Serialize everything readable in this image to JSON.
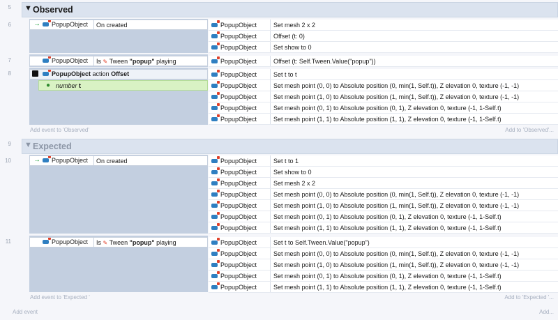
{
  "groups": [
    {
      "line": "5",
      "title": "Observed",
      "add_event": "Add event to 'Observed'",
      "add_to": "Add to 'Observed'..."
    },
    {
      "line": "9",
      "title": "Expected",
      "add_event": "Add event to 'Expected '",
      "add_to": "Add to 'Expected '..."
    }
  ],
  "line_numbers": [
    "6",
    "7",
    "8",
    "10",
    "11"
  ],
  "footer": {
    "add_event": "Add event",
    "add": "Add..."
  },
  "object_name": "PopupObject",
  "conditions": [
    {
      "object": "PopupObject",
      "text": "On created"
    },
    {
      "object": "PopupObject",
      "is": "Is",
      "tween_label": "Tween",
      "tween_name": "\"popup\"",
      "playing": "playing"
    },
    {
      "object": "PopupObject",
      "action_word": "action",
      "action_name": "Offset"
    },
    {
      "object": "PopupObject",
      "text": "On created"
    },
    {
      "object": "PopupObject",
      "is": "Is",
      "tween_label": "Tween",
      "tween_name": "\"popup\"",
      "playing": "playing"
    }
  ],
  "parameter": {
    "type": "number",
    "name": "t"
  },
  "actions": [
    "Set mesh 2 x 2",
    "Offset (t: 0)",
    "Set show to 0",
    "Offset (t: Self.Tween.Value(\"popup\"))",
    "Set t to t",
    "Set mesh point (0, 0) to Absolute position (0, min(1, Self.t)), Z elevation 0, texture (-1, -1)",
    "Set mesh point (1, 0) to Absolute position (1, min(1, Self.t)), Z elevation 0, texture (-1, -1)",
    "Set mesh point (0, 1) to Absolute position (0, 1), Z elevation 0, texture (-1, 1-Self.t)",
    "Set mesh point (1, 1) to Absolute position (1, 1), Z elevation 0, texture (-1, 1-Self.t)",
    "Set t to 1",
    "Set show to 0",
    "Set mesh 2 x 2",
    "Set mesh point (0, 0) to Absolute position (0, min(1, Self.t)), Z elevation 0, texture (-1, -1)",
    "Set mesh point (1, 0) to Absolute position (1, min(1, Self.t)), Z elevation 0, texture (-1, -1)",
    "Set mesh point (0, 1) to Absolute position (0, 1), Z elevation 0, texture (-1, 1-Self.t)",
    "Set mesh point (1, 1) to Absolute position (1, 1), Z elevation 0, texture (-1, 1-Self.t)",
    "Set t to Self.Tween.Value(\"popup\")",
    "Set mesh point (0, 0) to Absolute position (0, min(1, Self.t)), Z elevation 0, texture (-1, -1)",
    "Set mesh point (1, 0) to Absolute position (1, min(1, Self.t)), Z elevation 0, texture (-1, -1)",
    "Set mesh point (0, 1) to Absolute position (0, 1), Z elevation 0, texture (-1, 1-Self.t)",
    "Set mesh point (1, 1) to Absolute position (1, 1), Z elevation 0, texture (-1, 1-Self.t)"
  ],
  "icons": {
    "trigger": "green-arrow-icon",
    "object": "space-invader-icon",
    "action_func": "puzzle-icon",
    "param": "location-pin-icon",
    "tween": "tween-icon"
  }
}
